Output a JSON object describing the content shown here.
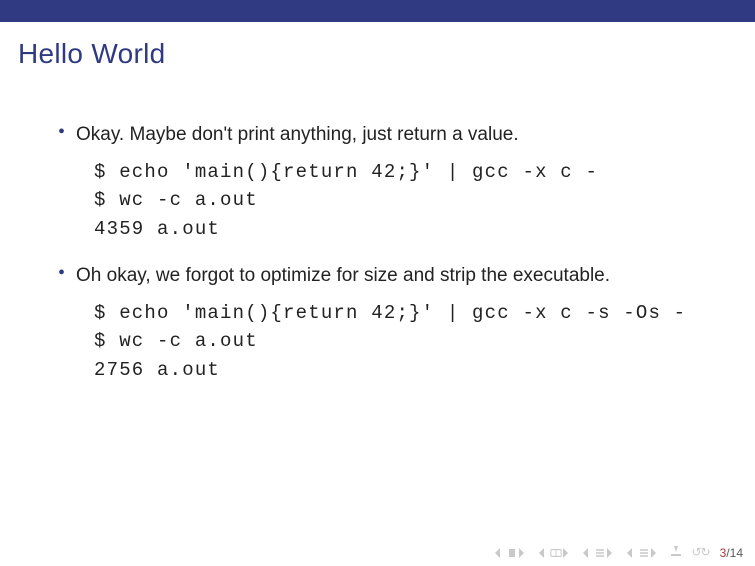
{
  "header": {
    "title": "Hello World"
  },
  "bullets": [
    {
      "text": "Okay. Maybe don't print anything, just return a value.",
      "code": "$ echo 'main(){return 42;}' | gcc -x c -\n$ wc -c a.out\n4359 a.out"
    },
    {
      "text": "Oh okay, we forgot to optimize for size and strip the executable.",
      "code": "$ echo 'main(){return 42;}' | gcc -x c -s -Os -\n$ wc -c a.out\n2756 a.out"
    }
  ],
  "footer": {
    "page_current": "3",
    "page_sep": "/",
    "page_total": "14"
  }
}
